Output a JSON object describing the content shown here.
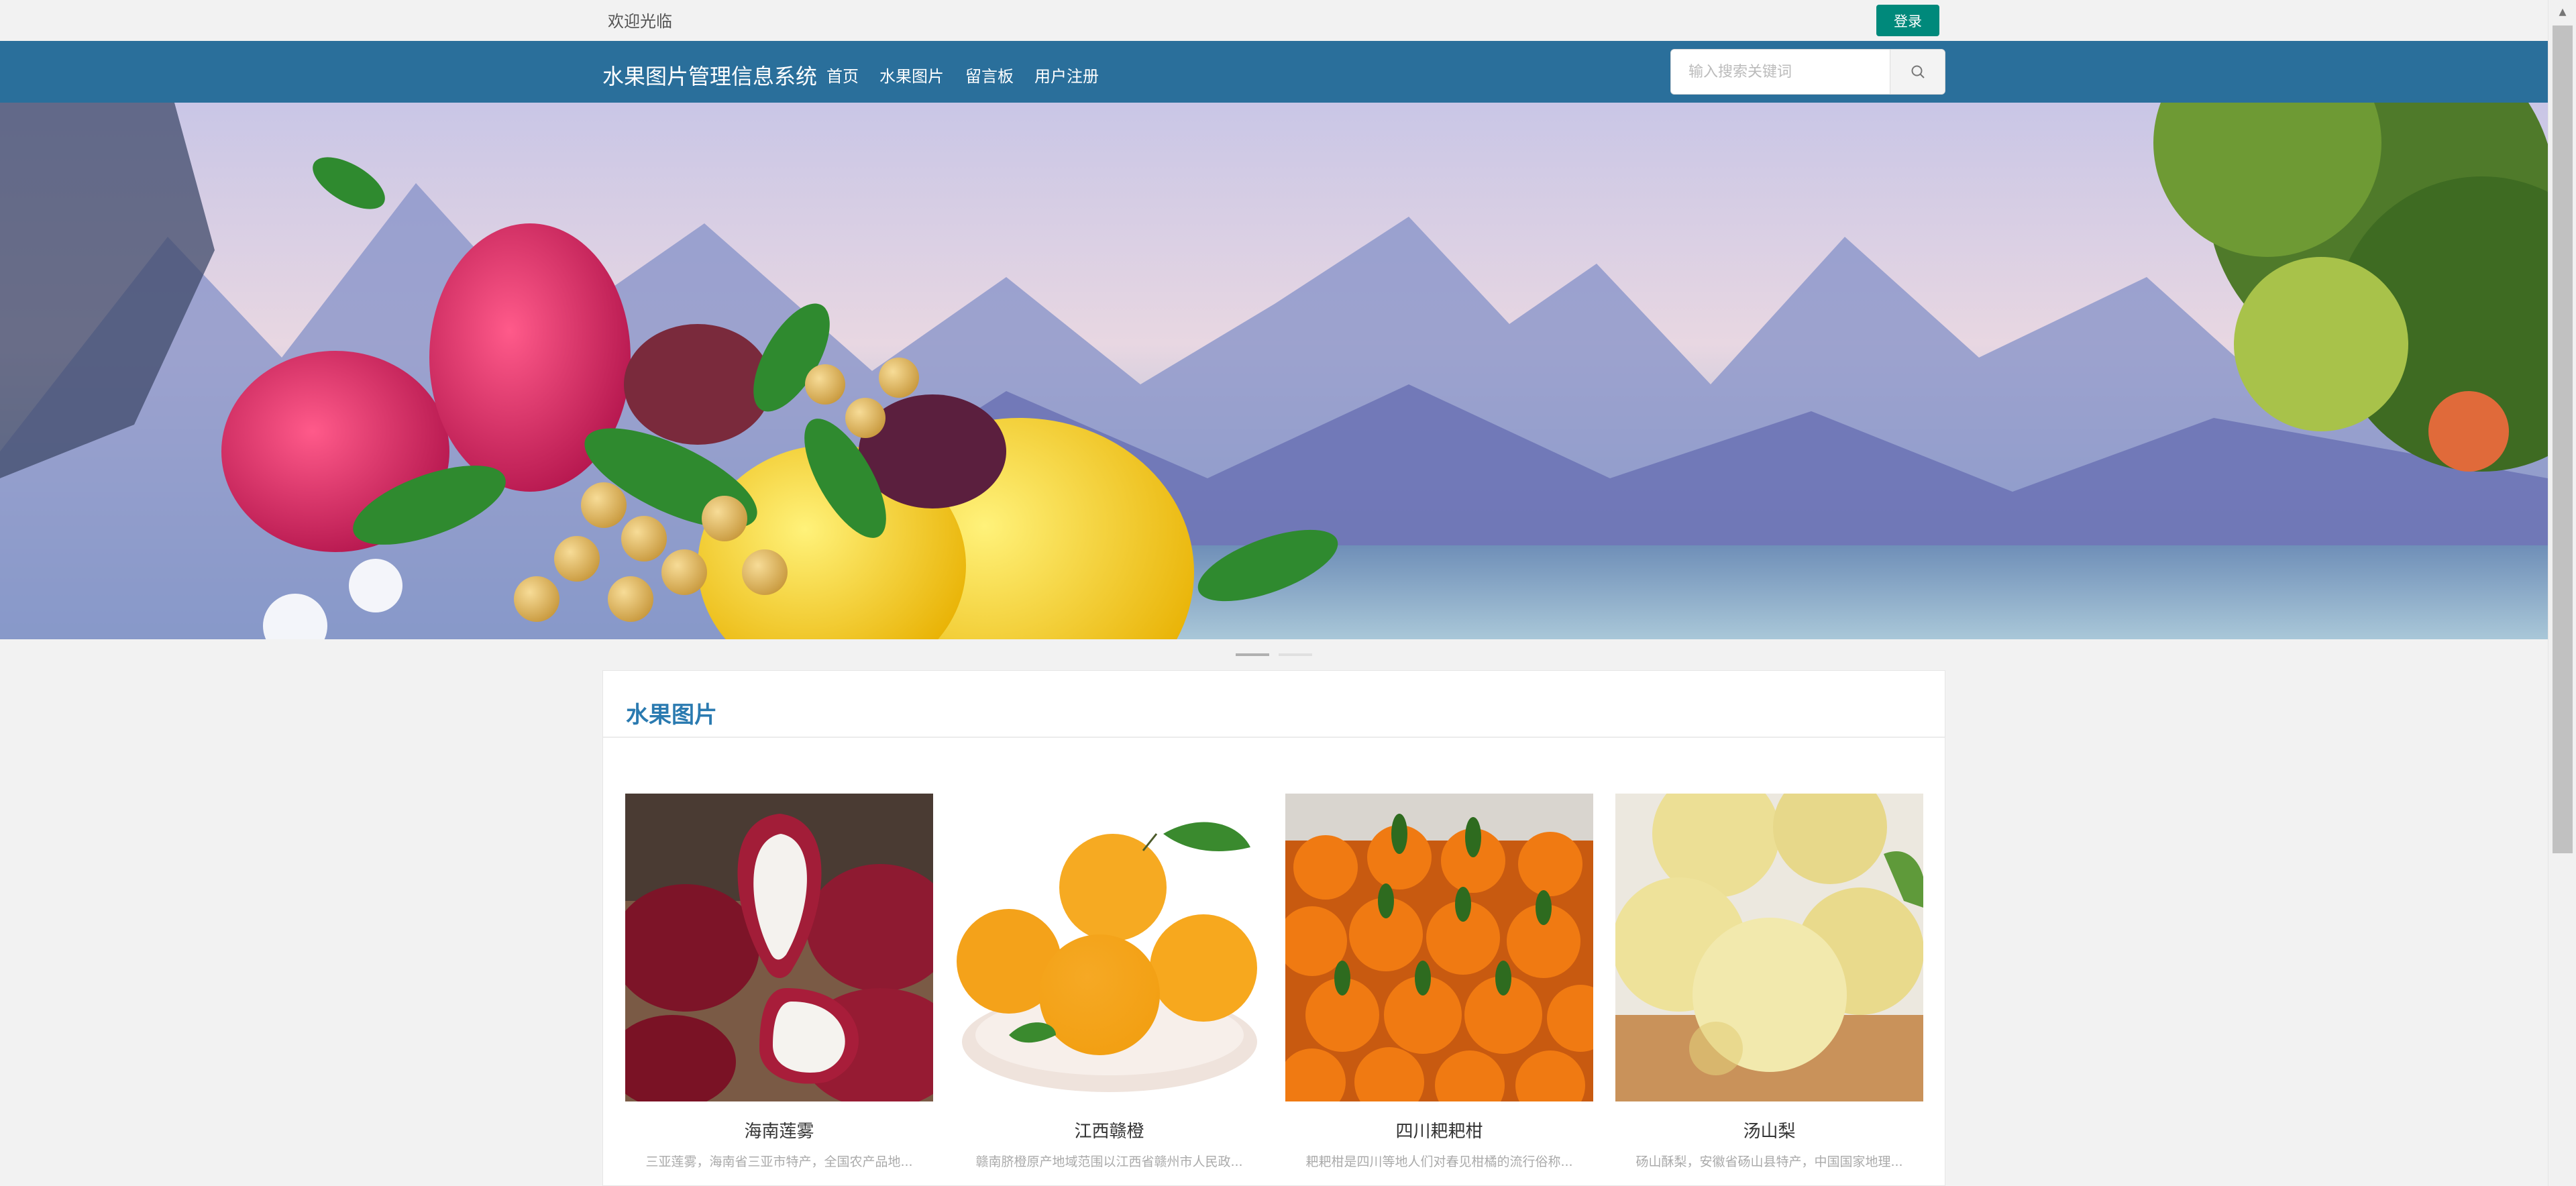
{
  "topbar": {
    "welcome_text": "欢迎光临",
    "login_label": "登录"
  },
  "header": {
    "brand": "水果图片管理信息系统",
    "nav": [
      {
        "label": "首页"
      },
      {
        "label": "水果图片"
      },
      {
        "label": "留言板"
      },
      {
        "label": "用户注册"
      }
    ],
    "search_placeholder": "输入搜索关键词"
  },
  "carousel": {
    "slide_count": 2,
    "active_index": 0
  },
  "section": {
    "title": "水果图片",
    "items": [
      {
        "name": "海南莲雾",
        "desc": "三亚莲雾，海南省三亚市特产，全国农产品地..."
      },
      {
        "name": "江西赣橙",
        "desc": "赣南脐橙原产地域范围以江西省赣州市人民政..."
      },
      {
        "name": "四川耙耙柑",
        "desc": "耙耙柑是四川等地人们对春见柑橘的流行俗称..."
      },
      {
        "name": "汤山梨",
        "desc": "砀山酥梨，安徽省砀山县特产，中国国家地理..."
      }
    ]
  },
  "colors": {
    "nav_bg": "#2a6f9b",
    "login_bg": "#00897b",
    "title_color": "#2a7ab0"
  }
}
